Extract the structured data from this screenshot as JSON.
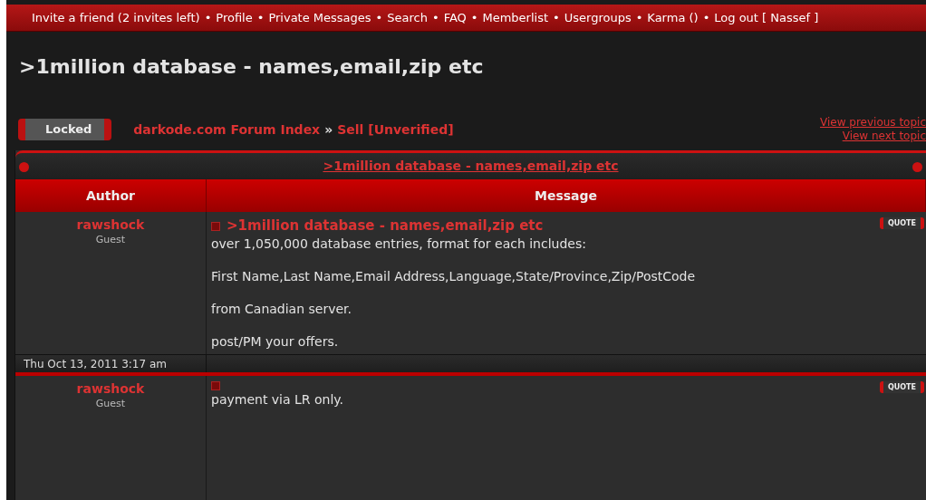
{
  "nav_links": [
    "Invite a friend (2 invites left)",
    "Profile",
    "Private Messages",
    "Search",
    "FAQ",
    "Memberlist",
    "Usergroups",
    "Karma ()",
    "Log out [ Nassef ]"
  ],
  "nav_separators": [
    "•",
    "•",
    "•",
    "•",
    "•",
    "•",
    "•",
    "•"
  ],
  "topic_title": ">1million database - names,email,zip etc",
  "locked_button": "Locked",
  "breadcrumb": [
    "darkode.com Forum Index",
    "Sell [Unverified]"
  ],
  "breadcrumb_separator": "»",
  "topic_nav": [
    "View previous topic",
    "View next topic"
  ],
  "table": {
    "title": ">1million database - names,email,zip etc",
    "columns": [
      "Author",
      "Message"
    ]
  },
  "posts": [
    {
      "author": "rawshock",
      "rank": "Guest",
      "subject": ">1million database - names,email,zip etc",
      "quote_button": "QUOTE",
      "paragraphs": [
        "over 1,050,000 database entries, format for each includes:",
        "First Name,Last Name,Email Address,Language,State/Province,Zip/PostCode",
        "from Canadian server.",
        "post/PM your offers."
      ],
      "date": "Thu Oct 13, 2011 3:17 am"
    },
    {
      "author": "rawshock",
      "rank": "Guest",
      "quote_button": "QUOTE",
      "paragraphs": [
        "payment via LR only."
      ]
    }
  ]
}
